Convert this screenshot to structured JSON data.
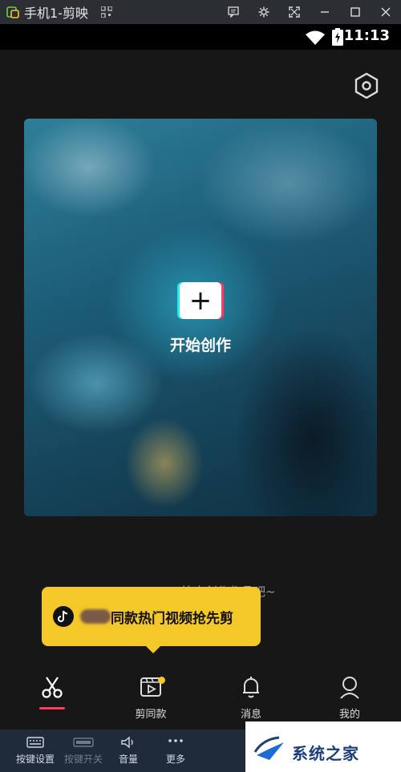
{
  "window": {
    "title": "手机1-剪映"
  },
  "status_bar": {
    "time": "11:13"
  },
  "hero": {
    "create_icon": "+",
    "create_label": "开始创作"
  },
  "tooltip": {
    "text": "同款热门视频抢先剪"
  },
  "hint": {
    "text": "快去创作作品吧~"
  },
  "tabs": [
    {
      "label": "",
      "icon": "scissors-icon",
      "active": true
    },
    {
      "label": "剪同款",
      "icon": "video-template-icon",
      "badge": true
    },
    {
      "label": "消息",
      "icon": "bell-icon"
    },
    {
      "label": "我的",
      "icon": "profile-icon"
    }
  ],
  "emulator_toolbar": [
    {
      "label": "按键设置",
      "icon": "keyboard-icon"
    },
    {
      "label": "按键开关",
      "icon": "toggle-icon",
      "disabled": true
    },
    {
      "label": "音量",
      "icon": "volume-icon"
    },
    {
      "label": "更多",
      "icon": "more-icon"
    }
  ],
  "watermark": {
    "text": "系统之家"
  },
  "colors": {
    "accent_red": "#ff3b5c",
    "tooltip_yellow": "#f5c82a",
    "teal": "#2ee6ea"
  }
}
